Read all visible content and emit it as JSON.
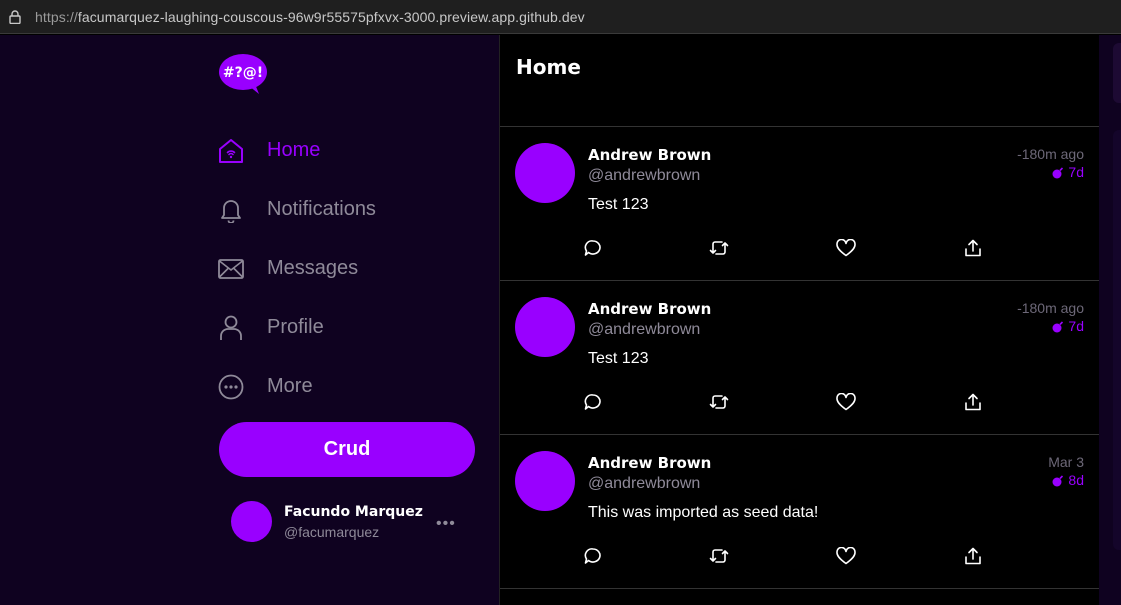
{
  "browser": {
    "url_protocol": "https://",
    "url_rest": "facumarquez-laughing-couscous-96w9r55575pfxvx-3000.preview.app.github.dev"
  },
  "logo": {
    "text": "#?@!",
    "icon": "speech-bubble-logo",
    "color": "#9900ff"
  },
  "nav": {
    "items": [
      {
        "label": "Home",
        "icon": "home-icon",
        "active": true
      },
      {
        "label": "Notifications",
        "icon": "bell-icon",
        "active": false
      },
      {
        "label": "Messages",
        "icon": "envelope-icon",
        "active": false
      },
      {
        "label": "Profile",
        "icon": "person-icon",
        "active": false
      },
      {
        "label": "More",
        "icon": "ellipsis-circle-icon",
        "active": false
      }
    ]
  },
  "crud_button": {
    "label": "Crud"
  },
  "account": {
    "display_name": "Facundo Marquez",
    "handle": "@facumarquez",
    "more": "•••"
  },
  "feed": {
    "title": "Home",
    "posts": [
      {
        "display_name": "Andrew Brown",
        "handle": "@andrewbrown",
        "time": "-180m ago",
        "expires": "7d",
        "message": "Test 123"
      },
      {
        "display_name": "Andrew Brown",
        "handle": "@andrewbrown",
        "time": "-180m ago",
        "expires": "7d",
        "message": "Test 123"
      },
      {
        "display_name": "Andrew Brown",
        "handle": "@andrewbrown",
        "time": "Mar 3",
        "expires": "8d",
        "message": "This was imported as seed data!"
      }
    ]
  },
  "colors": {
    "accent": "#9900ff",
    "sidebar_bg": "#0f0220",
    "feed_bg": "#000000",
    "muted_text": "#8f8a99"
  }
}
